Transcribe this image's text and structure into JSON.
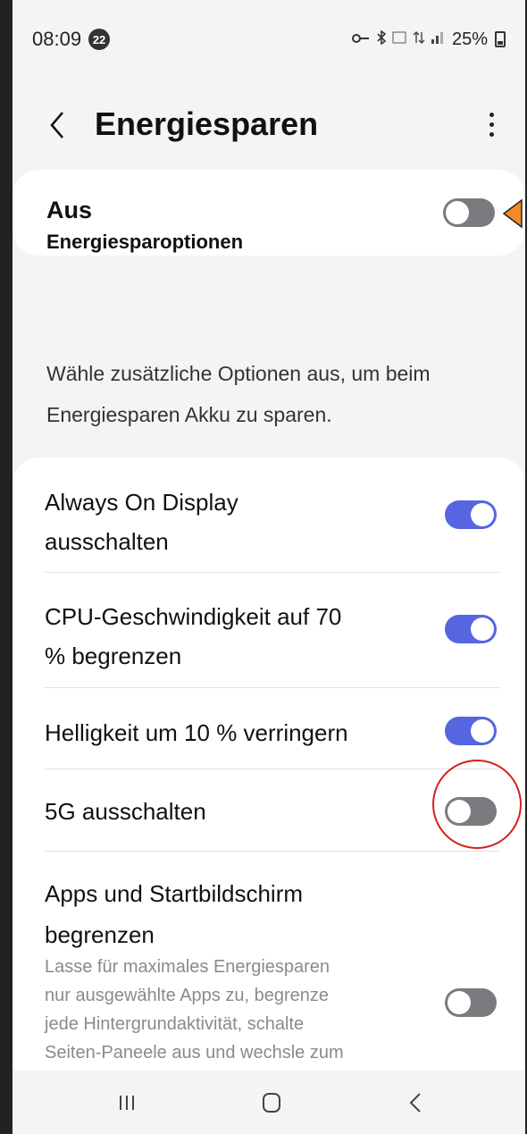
{
  "status_bar": {
    "time": "08:09",
    "notification_count": "22",
    "battery_percent": "25%",
    "icons": [
      "key-icon",
      "bluetooth-icon",
      "volte-icon",
      "data-icon",
      "signal-icon",
      "battery-icon"
    ]
  },
  "header": {
    "title": "Energiesparen"
  },
  "master_toggle": {
    "label": "Aus",
    "on": false
  },
  "section": {
    "title": "Energiesparoptionen",
    "description": "Wähle zusätzliche Optionen aus, um beim Energiesparen Akku zu sparen."
  },
  "options": [
    {
      "label_line1": "Always On Display",
      "label_line2": "ausschalten",
      "on": true
    },
    {
      "label_line1": "CPU-Geschwindigkeit auf 70",
      "label_line2": "% begrenzen",
      "on": true
    },
    {
      "label": "Helligkeit um 10 % verringern",
      "on": true
    },
    {
      "label": "5G ausschalten",
      "on": false
    },
    {
      "label_line1": "Apps und Startbildschirm",
      "label_line2": "begrenzen",
      "description_lines": [
        "Lasse für maximales Energiesparen",
        "nur ausgewählte Apps zu, begrenze",
        "jede Hintergrundaktivität, schalte",
        "Seiten-Paneele aus und wechsle zum"
      ],
      "on": false
    }
  ],
  "colors": {
    "toggle_on": "#5566e0",
    "toggle_off": "#7b7b7f",
    "annotation_circle": "#d62020",
    "annotation_arrow": "#f08a2a"
  }
}
